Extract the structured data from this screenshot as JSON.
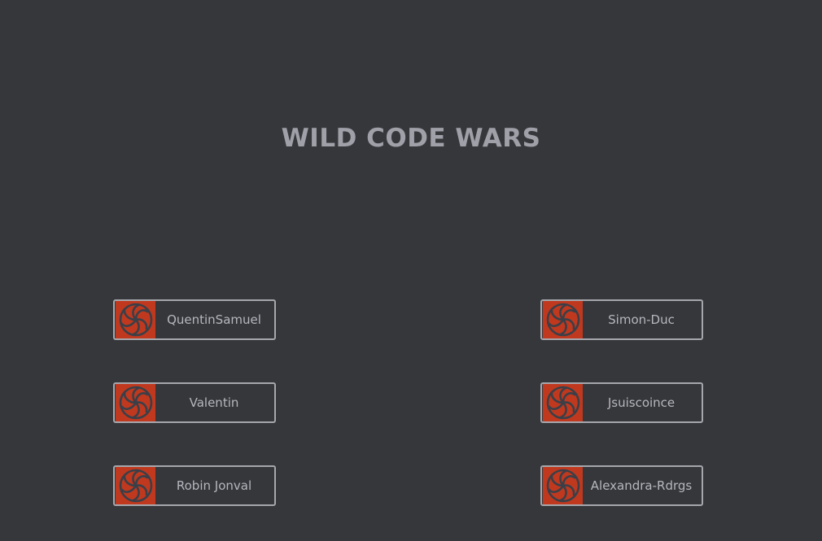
{
  "app": {
    "title": "WILD CODE WARS"
  },
  "players": [
    {
      "name": "QuentinSamuel",
      "avatar_icon": "spiral-flower-icon"
    },
    {
      "name": "Simon-Duc",
      "avatar_icon": "spiral-flower-icon"
    },
    {
      "name": "Valentin",
      "avatar_icon": "spiral-flower-icon"
    },
    {
      "name": "Jsuiscoince",
      "avatar_icon": "spiral-flower-icon"
    },
    {
      "name": "Robin Jonval",
      "avatar_icon": "spiral-flower-icon"
    },
    {
      "name": "Alexandra-Rdrgs",
      "avatar_icon": "spiral-flower-icon"
    }
  ],
  "colors": {
    "background": "#36373b",
    "title": "#9fa0a8",
    "card_border": "#a6a7ad",
    "avatar_bg": "#c0391f",
    "avatar_icon": "#3b3f48",
    "name_text": "#b6b7be"
  }
}
